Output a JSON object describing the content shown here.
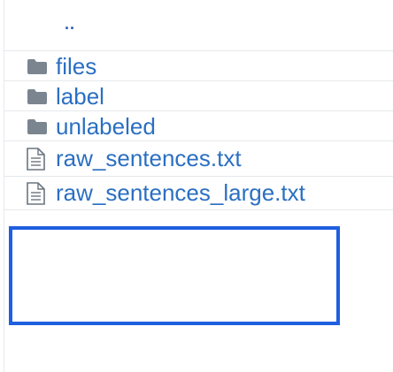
{
  "listing": {
    "parent_link": "..",
    "items": [
      {
        "type": "folder",
        "name": "files",
        "icon": "folder-icon"
      },
      {
        "type": "folder",
        "name": "label",
        "icon": "folder-icon"
      },
      {
        "type": "folder",
        "name": "unlabeled",
        "icon": "folder-icon"
      },
      {
        "type": "file",
        "name": "raw_sentences.txt",
        "icon": "file-text-icon"
      },
      {
        "type": "file",
        "name": "raw_sentences_large.txt",
        "icon": "file-text-icon"
      }
    ]
  },
  "colors": {
    "link": "#2b6fc2",
    "folder_icon": "#7a858f",
    "highlight_border": "#1f5fe0",
    "row_divider": "#e5e8ec"
  }
}
